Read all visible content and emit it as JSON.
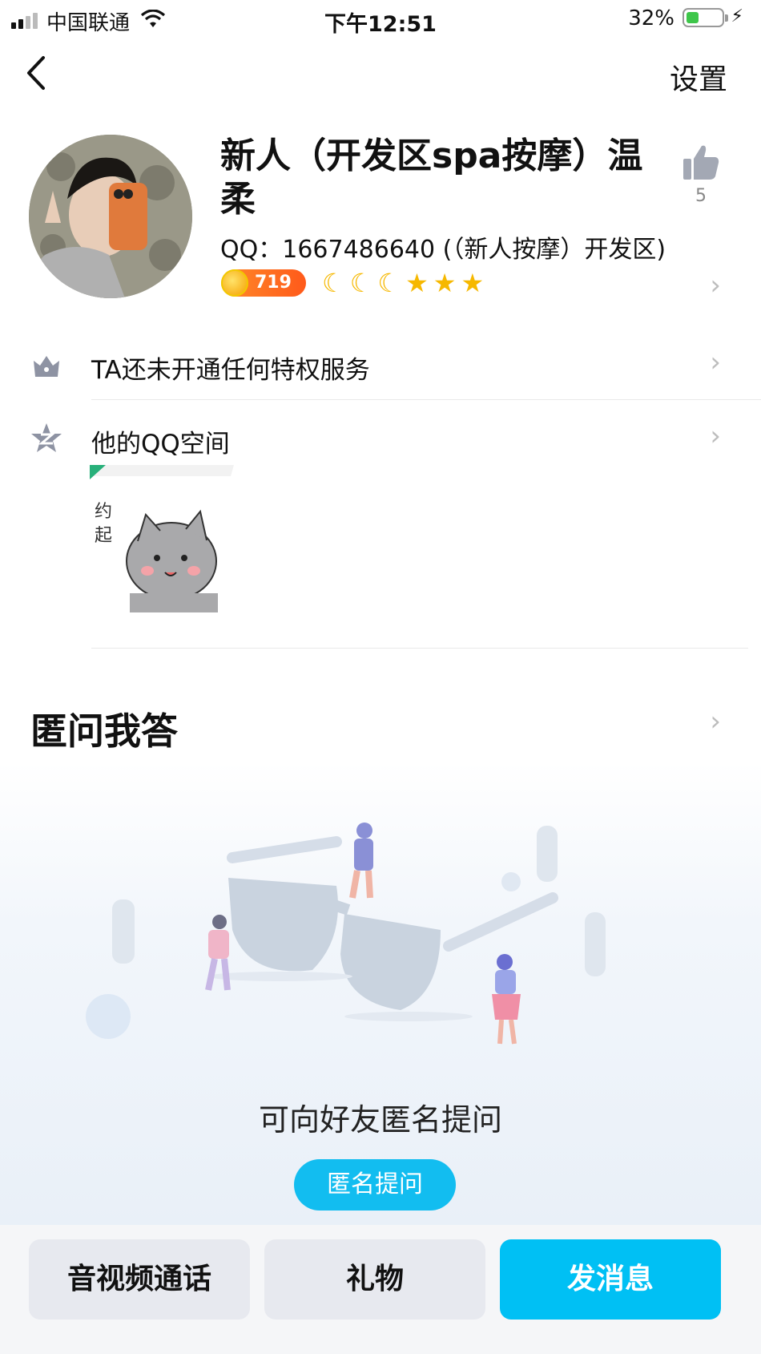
{
  "status_bar": {
    "carrier": "中国联通",
    "time": "下午12:51",
    "battery": "32%"
  },
  "nav": {
    "settings_label": "设置"
  },
  "profile": {
    "nickname": "新人（开发区spa按摩）温柔",
    "qq_line": "QQ：1667486640 (（新人按摩）开发区)",
    "like_count": "5",
    "level_value": "719",
    "level_icons": [
      "moon",
      "moon",
      "moon",
      "star",
      "star",
      "star"
    ]
  },
  "rows": {
    "privilege_label": "TA还未开通任何特权服务",
    "qzone_label": "他的QQ空间"
  },
  "sticker": {
    "text_line1": "约",
    "text_line2": "起"
  },
  "qa": {
    "title": "匿问我答",
    "empty_text": "可向好友匿名提问",
    "ask_button": "匿名提问"
  },
  "bottom_bar": {
    "call_label": "音视频通话",
    "gift_label": "礼物",
    "message_label": "发消息"
  },
  "colors": {
    "accent": "#00c0f4",
    "level_badge": "#ff6a1f",
    "star": "#f6b800"
  }
}
